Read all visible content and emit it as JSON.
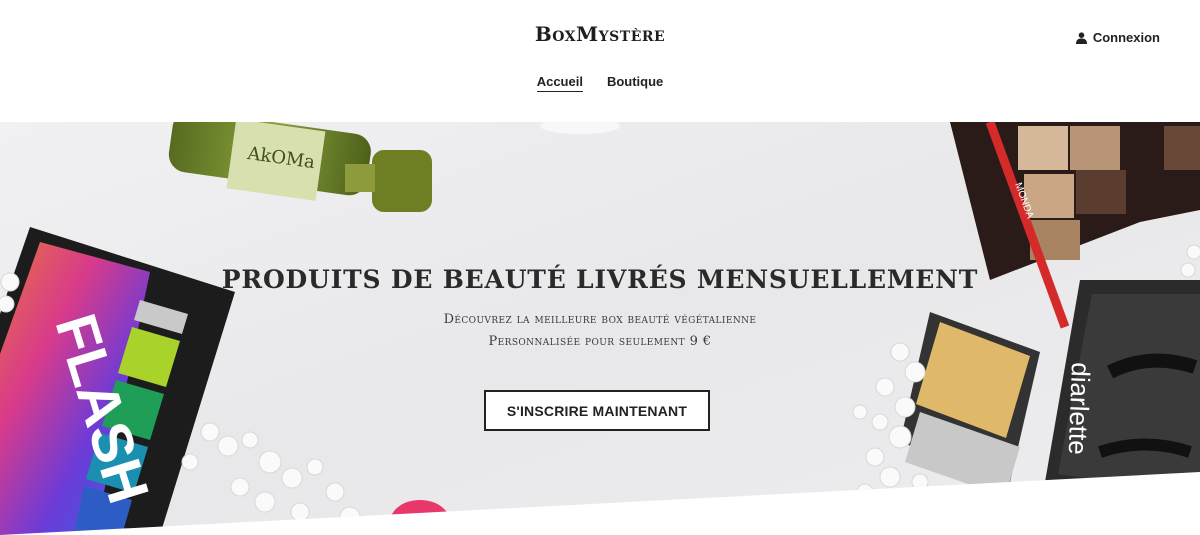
{
  "header": {
    "brand": "BoxMystère",
    "login_label": "Connexion"
  },
  "nav": {
    "items": [
      {
        "label": "Accueil",
        "active": true
      },
      {
        "label": "Boutique",
        "active": false
      }
    ]
  },
  "hero": {
    "title": "PRODUITS DE BEAUTÉ LIVRÉS MENSUELLEMENT",
    "subtitle_line1": "Découvrez la meilleure box beauté végétalienne",
    "subtitle_line2": "Personnalisée pour seulement 9 €",
    "cta_label": "S'INSCRIRE MAINTENANT",
    "palette_left_text": "FLASH",
    "bottle_label_text": "AkOMa",
    "lipliner_text": "MONDA",
    "lashes_box_text": "diarlette"
  },
  "colors": {
    "hero_background": "#ebebed",
    "text_dark": "#222222"
  },
  "icons": {
    "login": "user-icon"
  }
}
